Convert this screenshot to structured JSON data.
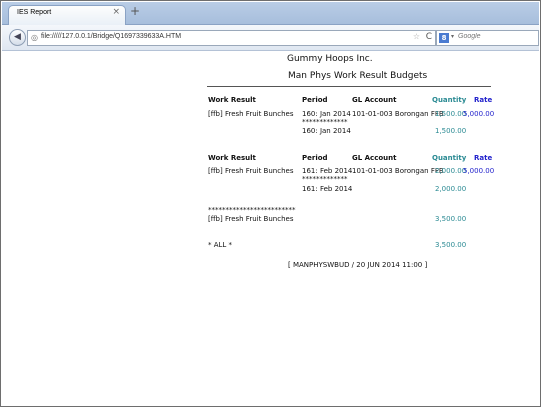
{
  "browser": {
    "tab_title": "IES Report",
    "tab_close": "×",
    "new_tab": "+",
    "back": "◀",
    "url": "file://///127.0.0.1/Bridge/Q1697339633A.HTM",
    "search_placeholder": "Google",
    "search_engine_letter": "8",
    "dropdown_glyph": "▾",
    "bookmark_glyph": "☆",
    "reload_glyph": "C",
    "globe_glyph": "◎"
  },
  "report": {
    "company": "Gummy Hoops Inc.",
    "title": "Man Phys Work Result Budgets",
    "headers": {
      "work_result": "Work Result",
      "period": "Period",
      "gl_account": "GL Account",
      "quantity": "Quantity",
      "rate": "Rate"
    },
    "group1": {
      "work_result": "[ffb] Fresh Fruit Bunches",
      "period": "160: Jan 2014",
      "gl_account": "101-01-003 Borongan FFB",
      "quantity": "1,500.00",
      "rate": "5,000.00",
      "stars": "*************",
      "subtotal_period": "160: Jan 2014",
      "subtotal_quantity": "1,500.00"
    },
    "group2": {
      "work_result": "[ffb] Fresh Fruit Bunches",
      "period": "161: Feb 2014",
      "gl_account": "101-01-003 Borongan FFB",
      "quantity": "2,000.00",
      "rate": "5,000.00",
      "stars": "*************",
      "subtotal_period": "161: Feb 2014",
      "subtotal_quantity": "2,000.00"
    },
    "total_stars": "*************************",
    "total_work_result": "[ffb] Fresh Fruit Bunches",
    "total_quantity": "3,500.00",
    "all_label": "* ALL *",
    "all_quantity": "3,500.00",
    "footer": "[ MANPHYSWBUD / 20 JUN 2014 11:00 ]"
  }
}
